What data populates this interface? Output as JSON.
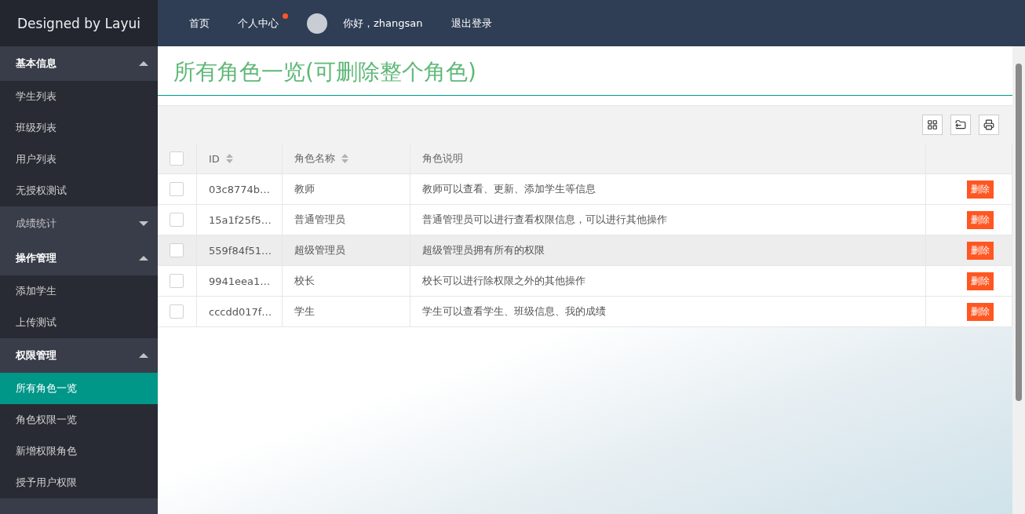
{
  "logo": "Designed by Layui",
  "nav": [
    {
      "label": "首页",
      "badge": false
    },
    {
      "label": "个人中心",
      "badge": true
    }
  ],
  "user": {
    "greeting": "你好，zhangsan",
    "logout": "退出登录"
  },
  "sidebar": [
    {
      "label": "基本信息",
      "expanded": true,
      "children": [
        {
          "label": "学生列表",
          "selected": false
        },
        {
          "label": "班级列表",
          "selected": false
        },
        {
          "label": "用户列表",
          "selected": false
        },
        {
          "label": "无授权测试",
          "selected": false
        }
      ]
    },
    {
      "label": "成绩统计",
      "expanded": false
    },
    {
      "label": "操作管理",
      "expanded": true,
      "children": [
        {
          "label": "添加学生",
          "selected": false
        },
        {
          "label": "上传测试",
          "selected": false
        }
      ]
    },
    {
      "label": "权限管理",
      "expanded": true,
      "children": [
        {
          "label": "所有角色一览",
          "selected": true
        },
        {
          "label": "角色权限一览",
          "selected": false
        },
        {
          "label": "新增权限角色",
          "selected": false
        },
        {
          "label": "授予用户权限",
          "selected": false
        }
      ]
    }
  ],
  "page_title": "所有角色一览(可删除整个角色)",
  "table": {
    "all_checked": false,
    "columns": [
      {
        "label": "ID",
        "sortable": true
      },
      {
        "label": "角色名称",
        "sortable": true
      },
      {
        "label": "角色说明",
        "sortable": false
      }
    ],
    "rows": [
      {
        "checked": false,
        "highlighted": false,
        "id": "03c8774b…",
        "name": "教师",
        "description": "教师可以查看、更新、添加学生等信息",
        "action": "删除"
      },
      {
        "checked": false,
        "highlighted": false,
        "id": "15a1f25f5…",
        "name": "普通管理员",
        "description": "普通管理员可以进行查看权限信息，可以进行其他操作",
        "action": "删除"
      },
      {
        "checked": false,
        "highlighted": true,
        "id": "559f84f51…",
        "name": "超级管理员",
        "description": "超级管理员拥有所有的权限",
        "action": "删除"
      },
      {
        "checked": false,
        "highlighted": false,
        "id": "9941eea1…",
        "name": "校长",
        "description": "校长可以进行除权限之外的其他操作",
        "action": "删除"
      },
      {
        "checked": false,
        "highlighted": false,
        "id": "cccdd017f…",
        "name": "学生",
        "description": "学生可以查看学生、班级信息、我的成绩",
        "action": "删除"
      }
    ]
  }
}
